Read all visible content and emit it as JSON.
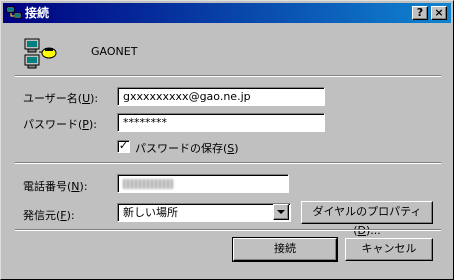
{
  "window": {
    "title": "接続",
    "help_label": "?",
    "close_label": "×"
  },
  "connection": {
    "name": "GAONET"
  },
  "user": {
    "label": "ユーザー名(",
    "accel": "U",
    "label_end": "):",
    "value": "gxxxxxxxxx@gao.ne.jp"
  },
  "password": {
    "label": "パスワード(",
    "accel": "P",
    "label_end": "):",
    "value": "********",
    "save_label": "パスワードの保存(",
    "save_accel": "S",
    "save_end": ")",
    "save_checked": true,
    "check_mark": "✓"
  },
  "phone": {
    "label": "電話番号(",
    "accel": "N",
    "label_end": "):"
  },
  "dial_from": {
    "label": "発信元(",
    "accel": "F",
    "label_end": "):",
    "selected": "新しい場所"
  },
  "buttons": {
    "dial_properties": "ダイヤルのプロパティ(",
    "dial_properties_accel": "D",
    "dial_properties_end": ")...",
    "connect": "接続",
    "cancel": "キャンセル"
  }
}
